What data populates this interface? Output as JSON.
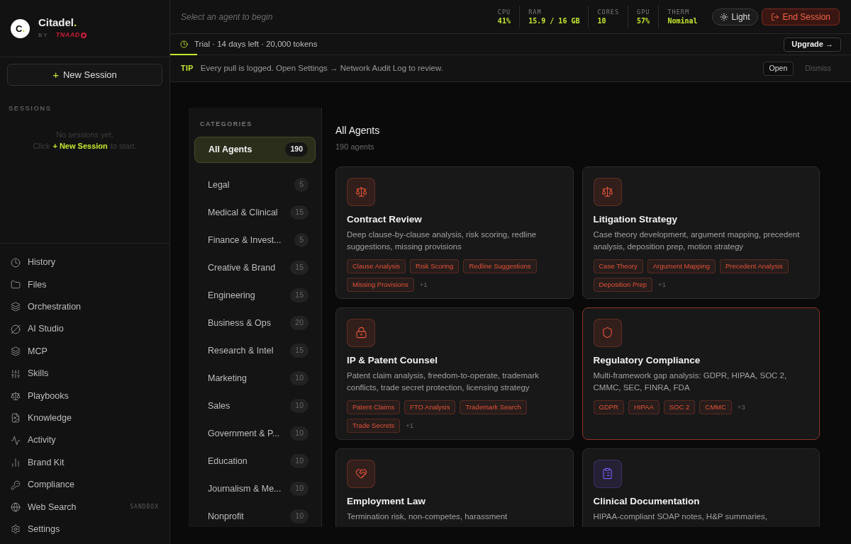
{
  "brand": {
    "logo_letter": "C",
    "logo_dot": ".",
    "name": "Citadel",
    "name_dot": ".",
    "by": "BY",
    "maker": "TNAAD"
  },
  "new_session": {
    "icon": "+",
    "label": "New Session"
  },
  "sessions": {
    "title": "SESSIONS",
    "empty_line1": "No sessions yet.",
    "empty_pre": "Click",
    "empty_link": "+ New Session",
    "empty_post": "to start."
  },
  "nav": [
    {
      "label": "History"
    },
    {
      "label": "Files"
    },
    {
      "label": "Orchestration"
    },
    {
      "label": "AI Studio"
    },
    {
      "label": "MCP"
    },
    {
      "label": "Skills"
    },
    {
      "label": "Playbooks"
    },
    {
      "label": "Knowledge"
    },
    {
      "label": "Activity"
    },
    {
      "label": "Brand Kit"
    },
    {
      "label": "Compliance"
    },
    {
      "label": "Web Search",
      "badge": "SANDBOX"
    },
    {
      "label": "Settings"
    }
  ],
  "topbar": {
    "placeholder": "Select an agent to begin",
    "metrics": [
      {
        "label": "CPU",
        "value": "41%"
      },
      {
        "label": "RAM",
        "value": "15.9 / 16 GB"
      },
      {
        "label": "CORES",
        "value": "10"
      },
      {
        "label": "GPU",
        "value": "57%"
      },
      {
        "label": "THERM",
        "value": "Nominal"
      }
    ],
    "theme_button": "Light",
    "end_button": "End Session"
  },
  "trial": {
    "text": "Trial · 14 days left · 20,000 tokens",
    "level": 0.04,
    "upgrade": "Upgrade →"
  },
  "tip": {
    "tag": "TIP",
    "text": "Every pull is logged. Open Settings → Network Audit Log to review.",
    "open": "Open",
    "dismiss": "Dismiss"
  },
  "categories": {
    "title": "CATEGORIES",
    "items": [
      {
        "label": "All Agents",
        "count": "190",
        "selected": true
      },
      {
        "label": "Legal",
        "count": "5",
        "selected": false
      },
      {
        "label": "Medical & Clinical",
        "count": "15",
        "selected": false
      },
      {
        "label": "Finance & Invest...",
        "count": "5",
        "selected": false
      },
      {
        "label": "Creative & Brand",
        "count": "15",
        "selected": false
      },
      {
        "label": "Engineering",
        "count": "15",
        "selected": false
      },
      {
        "label": "Business & Ops",
        "count": "20",
        "selected": false
      },
      {
        "label": "Research & Intel",
        "count": "15",
        "selected": false
      },
      {
        "label": "Marketing",
        "count": "10",
        "selected": false
      },
      {
        "label": "Sales",
        "count": "10",
        "selected": false
      },
      {
        "label": "Government & P...",
        "count": "10",
        "selected": false
      },
      {
        "label": "Education",
        "count": "10",
        "selected": false
      },
      {
        "label": "Journalism & Me...",
        "count": "10",
        "selected": false
      },
      {
        "label": "Nonprofit",
        "count": "10",
        "selected": false
      }
    ]
  },
  "agents": {
    "title": "All Agents",
    "count": "190 agents",
    "cards": [
      {
        "title": "Contract Review",
        "color": "#e0533a",
        "highlighted": false,
        "description": "Deep clause-by-clause analysis, risk scoring, redline suggestions, missing provisions",
        "tags": [
          "Clause Analysis",
          "Risk Scoring",
          "Redline Suggestions",
          "Missing Provisions"
        ],
        "more": "+1"
      },
      {
        "title": "Litigation Strategy",
        "color": "#e0533a",
        "highlighted": false,
        "description": "Case theory development, argument mapping, precedent analysis, deposition prep, motion strategy",
        "tags": [
          "Case Theory",
          "Argument Mapping",
          "Precedent Analysis",
          "Deposition Prep"
        ],
        "more": "+1"
      },
      {
        "title": "IP & Patent Counsel",
        "color": "#e0533a",
        "highlighted": false,
        "description": "Patent claim analysis, freedom-to-operate, trademark conflicts, trade secret protection, licensing strategy",
        "tags": [
          "Patent Claims",
          "FTO Analysis",
          "Trademark Search",
          "Trade Secrets"
        ],
        "more": "+1"
      },
      {
        "title": "Regulatory Compliance",
        "color": "#e0533a",
        "highlighted": true,
        "description": "Multi-framework gap analysis: GDPR, HIPAA, SOC 2, CMMC, SEC, FINRA, FDA",
        "tags": [
          "GDPR",
          "HIPAA",
          "SOC 2",
          "CMMC"
        ],
        "more": "+3"
      },
      {
        "title": "Employment Law",
        "color": "#e0533a",
        "highlighted": false,
        "description": "Termination risk, non-competes, harassment"
      },
      {
        "title": "Clinical Documentation",
        "color": "#7c5cf0",
        "highlighted": false,
        "description": "HIPAA-compliant SOAP notes, H&P summaries,"
      }
    ]
  }
}
